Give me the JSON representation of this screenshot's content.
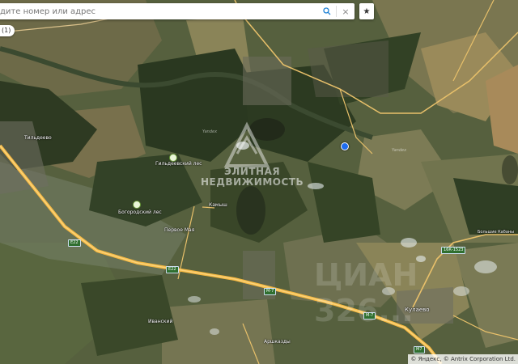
{
  "search": {
    "placeholder": "дите номер или адрес",
    "search_icon": "search-icon",
    "close_icon": "close-icon",
    "close_glyph": "×"
  },
  "favorite": {
    "icon": "star-icon",
    "glyph": "★"
  },
  "layer_pill": {
    "label": "(1)"
  },
  "places": [
    {
      "id": "tsyldeevo",
      "label": "Тильдеево"
    },
    {
      "id": "gil_forest",
      "label": "Гильдеевский лес"
    },
    {
      "id": "bogorod_forest",
      "label": "Богородский лес"
    },
    {
      "id": "kamysh",
      "label": "Камыш"
    },
    {
      "id": "pervomay",
      "label": "Первое Мая"
    },
    {
      "id": "kulaevo",
      "label": "Кулаево"
    },
    {
      "id": "arshkazdy",
      "label": "Аршказды"
    },
    {
      "id": "ivanskaya",
      "label": "Иванский"
    },
    {
      "id": "bolshaya",
      "label": "Большие Кабаны"
    },
    {
      "id": "yandex1",
      "label": "Yandex"
    },
    {
      "id": "yandex2",
      "label": "Yandex"
    }
  ],
  "roads": [
    {
      "id": "e22a",
      "label": "E22"
    },
    {
      "id": "e22b",
      "label": "E22"
    },
    {
      "id": "m7a",
      "label": "M-7"
    },
    {
      "id": "m7b",
      "label": "M-7"
    },
    {
      "id": "m7c",
      "label": "М7"
    },
    {
      "id": "route1",
      "label": "16К-1523"
    }
  ],
  "watermark": {
    "line1": "ЭЛИТНАЯ",
    "line2": "НЕДВИЖИМОСТЬ",
    "big_text": "ЦИАН 326..."
  },
  "copyright": "© Яндекс, © Antrix Corporation Ltd.",
  "colors": {
    "highway": "#f5b942",
    "secondary_road": "#e8c06a",
    "forest": "#2f3f22",
    "field": "#8a8a5a",
    "pin": "#1e6cf0"
  }
}
